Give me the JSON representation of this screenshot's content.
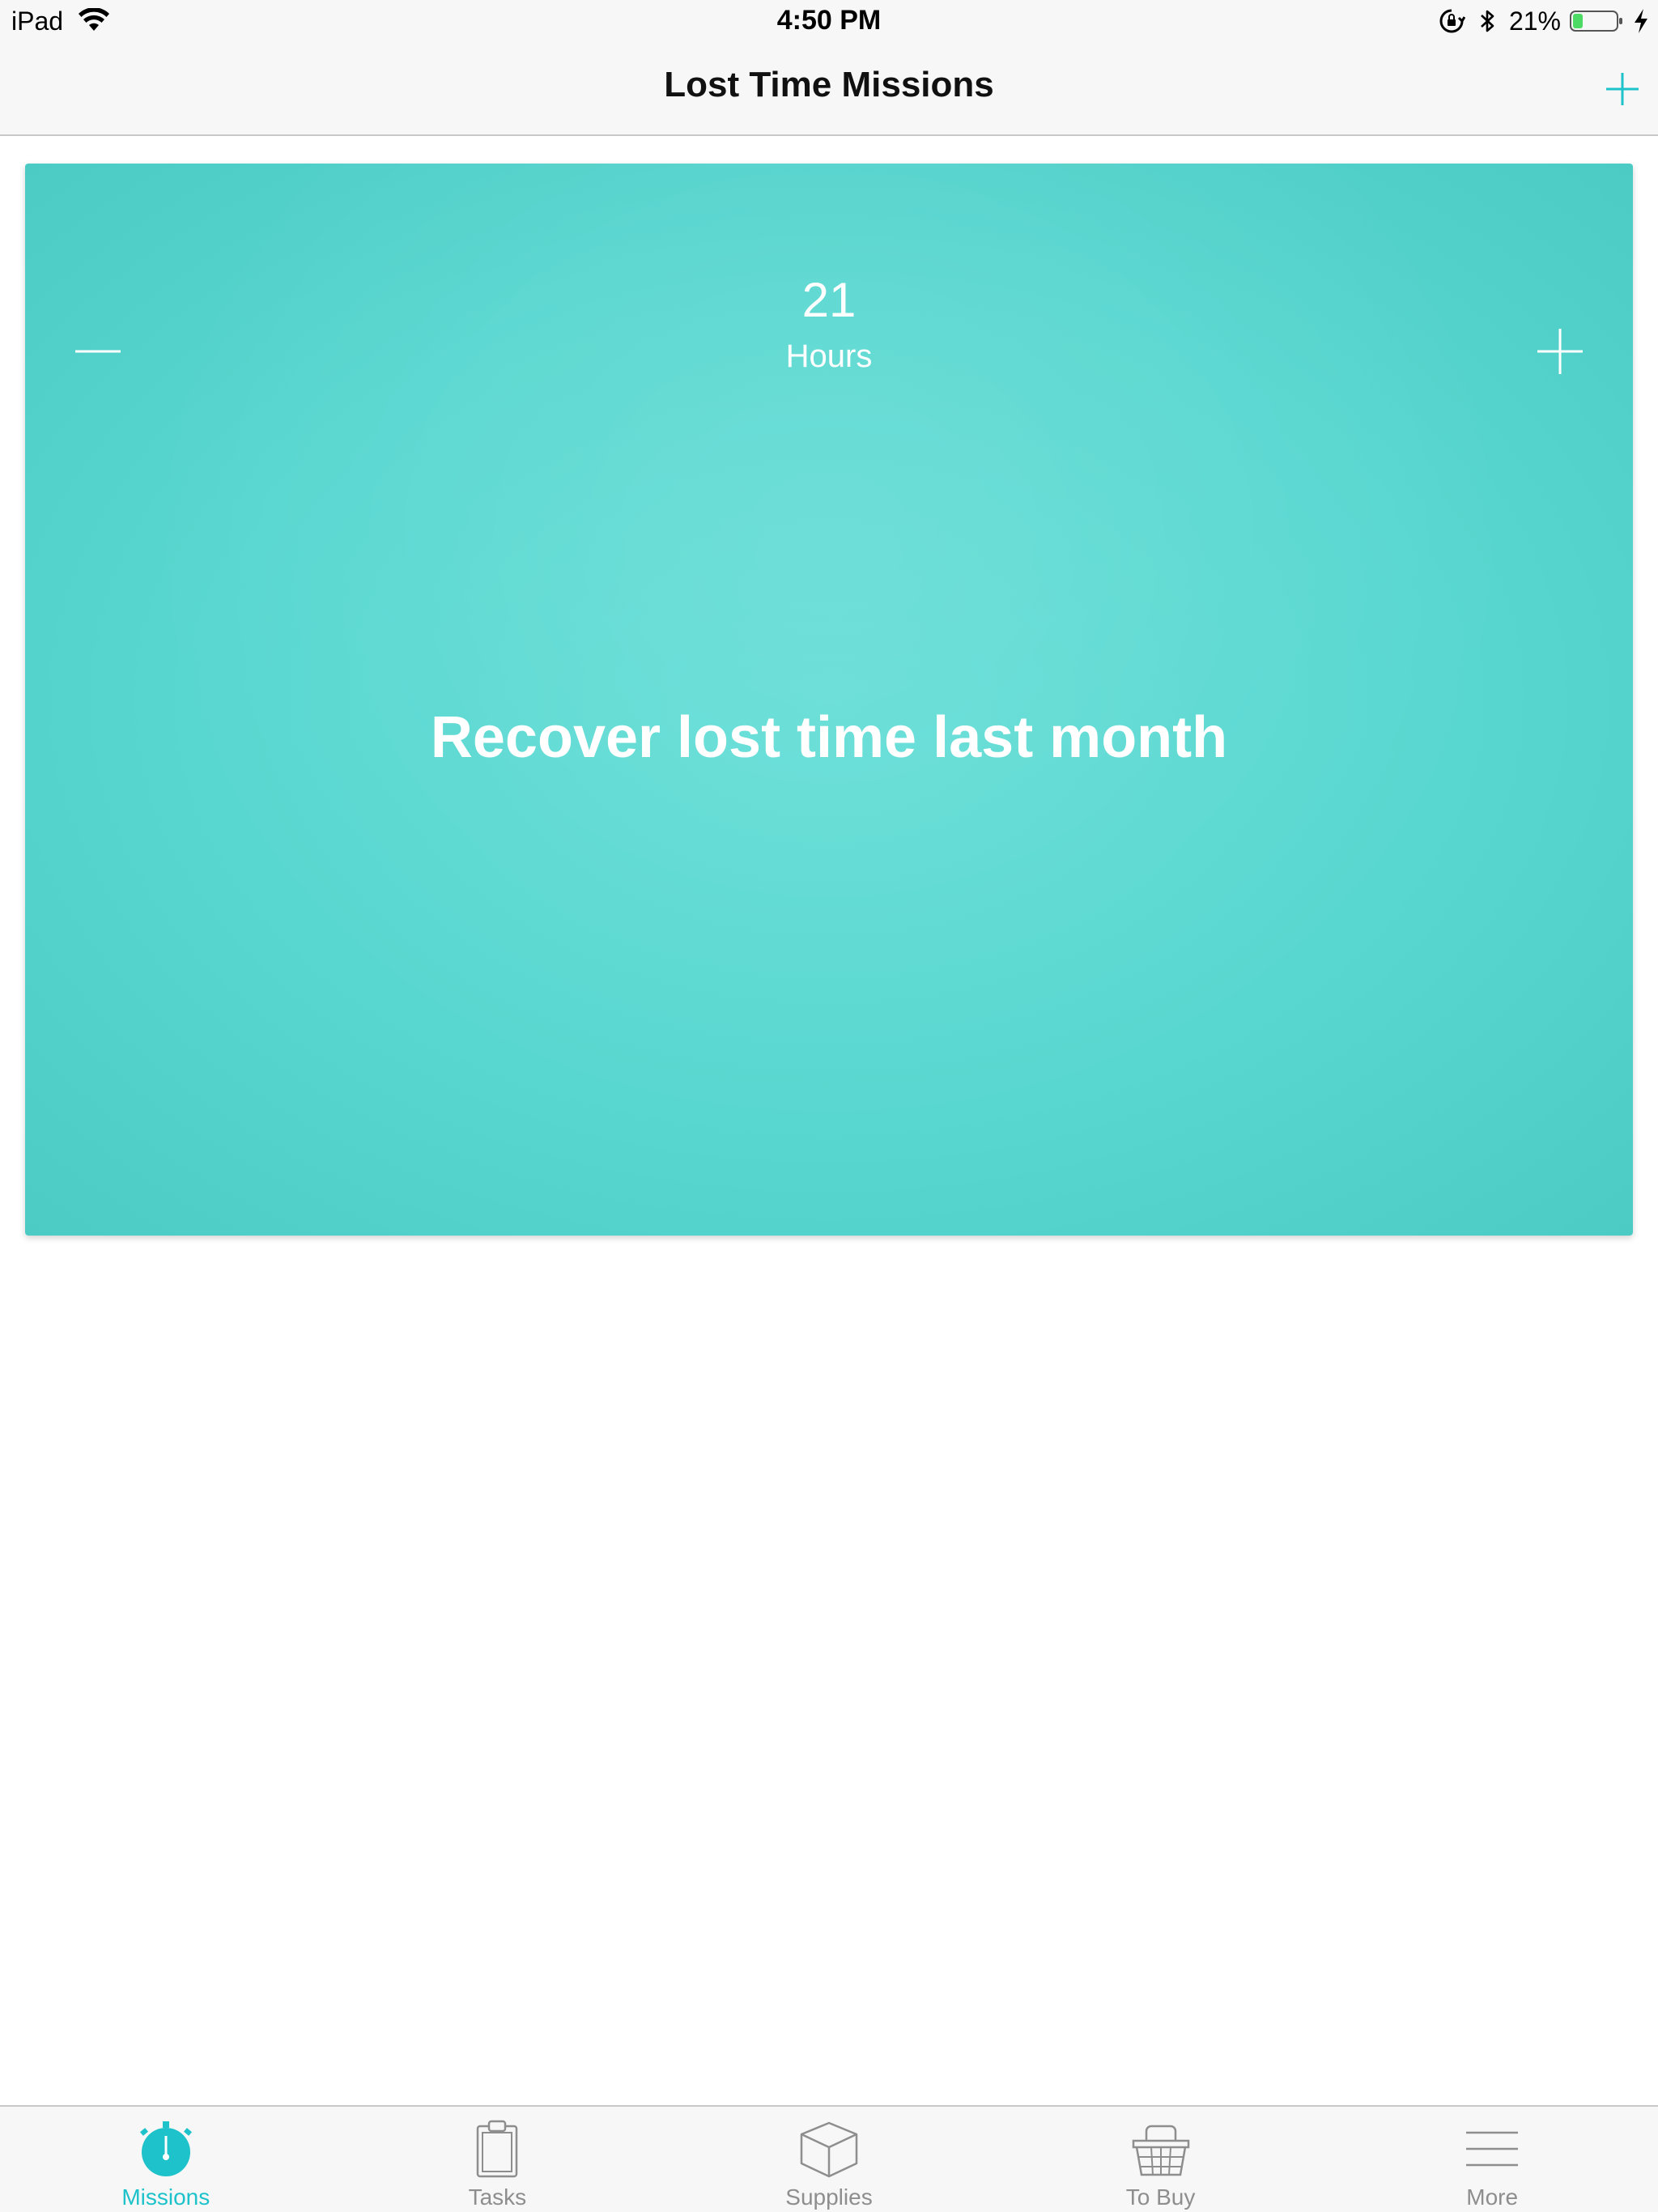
{
  "status_bar": {
    "device": "iPad",
    "time": "4:50 PM",
    "battery_percent": "21%"
  },
  "nav": {
    "title": "Lost Time Missions"
  },
  "mission": {
    "count": "21",
    "unit": "Hours",
    "title": "Recover lost time last month"
  },
  "tabs": [
    {
      "label": "Missions",
      "icon": "stopwatch-icon",
      "active": true
    },
    {
      "label": "Tasks",
      "icon": "clipboard-icon",
      "active": false
    },
    {
      "label": "Supplies",
      "icon": "box-icon",
      "active": false
    },
    {
      "label": "To Buy",
      "icon": "basket-icon",
      "active": false
    },
    {
      "label": "More",
      "icon": "menu-lines-icon",
      "active": false
    }
  ],
  "colors": {
    "accent": "#1ec2ca",
    "card": "#58d7d0",
    "tab_inactive": "#8e8e8e"
  }
}
